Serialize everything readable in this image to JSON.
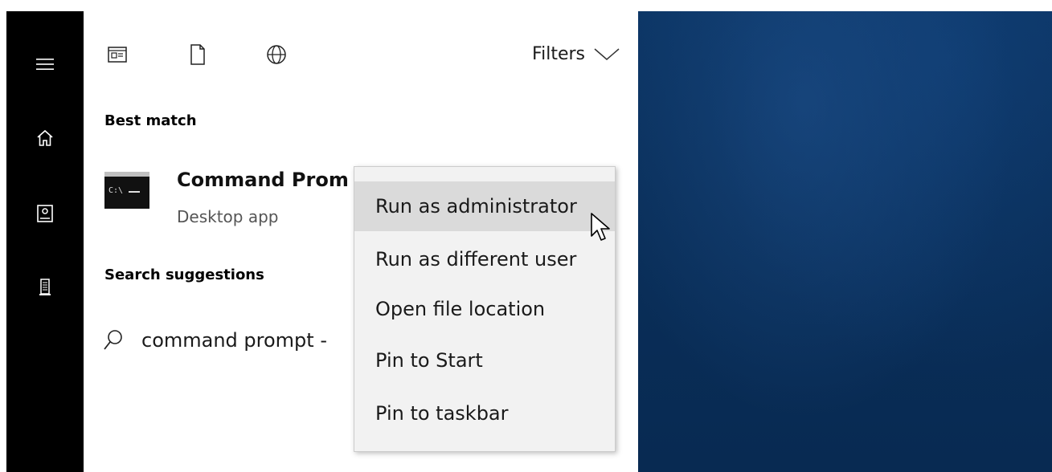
{
  "toolbar": {
    "filters_label": "Filters"
  },
  "sidebar": {
    "items": [
      {
        "name": "menu",
        "icon": "hamburger-icon"
      },
      {
        "name": "home",
        "icon": "home-icon"
      },
      {
        "name": "notebook",
        "icon": "notebook-icon"
      },
      {
        "name": "device",
        "icon": "device-icon"
      }
    ]
  },
  "results": {
    "best_match_heading": "Best match",
    "best_match": {
      "title": "Command Prom",
      "subtitle": "Desktop app",
      "icon": "command-prompt-icon"
    },
    "suggestions_heading": "Search suggestions",
    "suggestions": [
      {
        "text": "command prompt -",
        "icon": "search-icon"
      }
    ]
  },
  "context_menu": {
    "items": [
      {
        "label": "Run as administrator",
        "hovered": true
      },
      {
        "label": "Run as different user",
        "hovered": false
      },
      {
        "label": "Open file location",
        "hovered": false
      },
      {
        "label": "Pin to Start",
        "hovered": false
      },
      {
        "label": "Pin to taskbar",
        "hovered": false
      }
    ]
  },
  "colors": {
    "rail": "#000000",
    "panel": "#ffffff",
    "menu_bg": "#f2f2f2",
    "menu_hover": "#dadada",
    "desktop": "#0a2f5a"
  }
}
